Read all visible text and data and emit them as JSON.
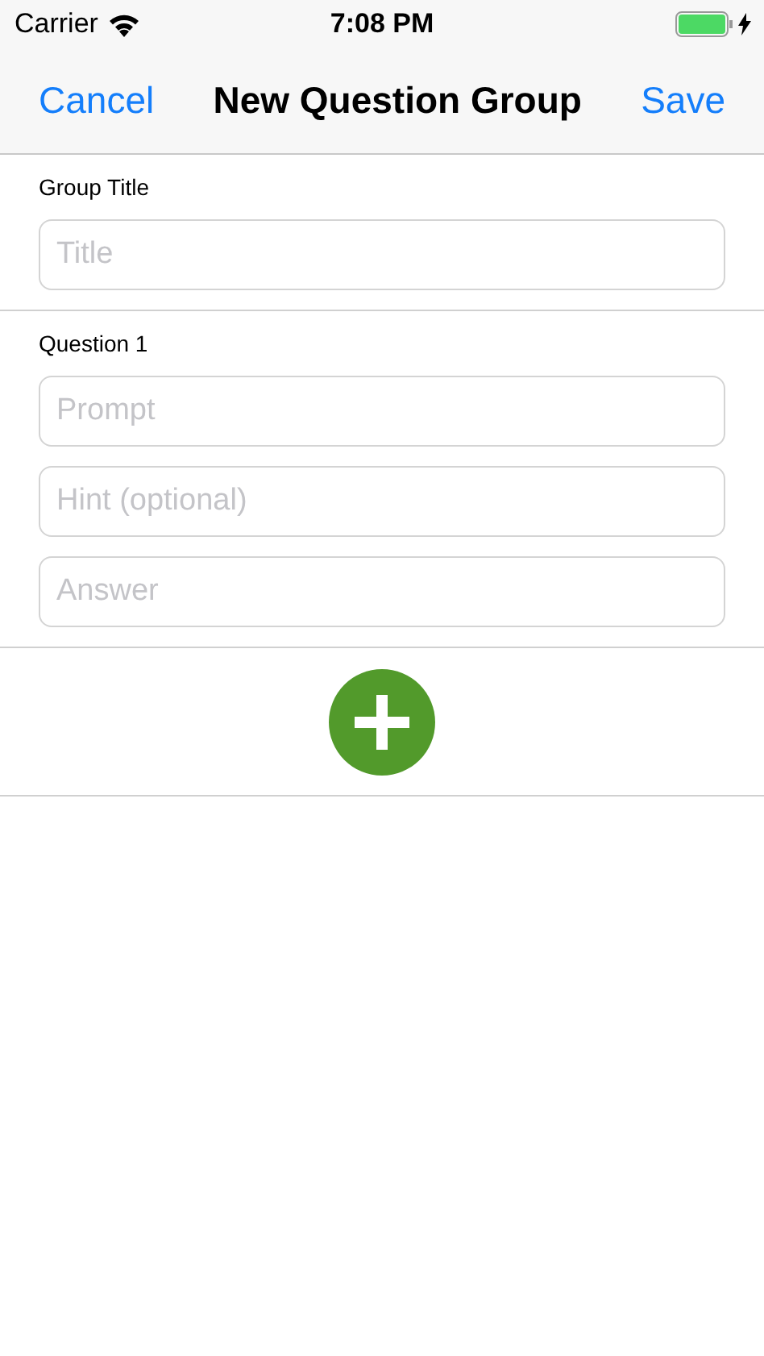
{
  "status_bar": {
    "carrier": "Carrier",
    "time": "7:08 PM"
  },
  "nav_bar": {
    "left_button": "Cancel",
    "title": "New Question Group",
    "right_button": "Save"
  },
  "sections": [
    {
      "label": "Group Title",
      "fields": [
        {
          "placeholder": "Title"
        }
      ]
    },
    {
      "label": "Question 1",
      "fields": [
        {
          "placeholder": "Prompt"
        },
        {
          "placeholder": "Hint (optional)"
        },
        {
          "placeholder": "Answer"
        }
      ]
    }
  ]
}
